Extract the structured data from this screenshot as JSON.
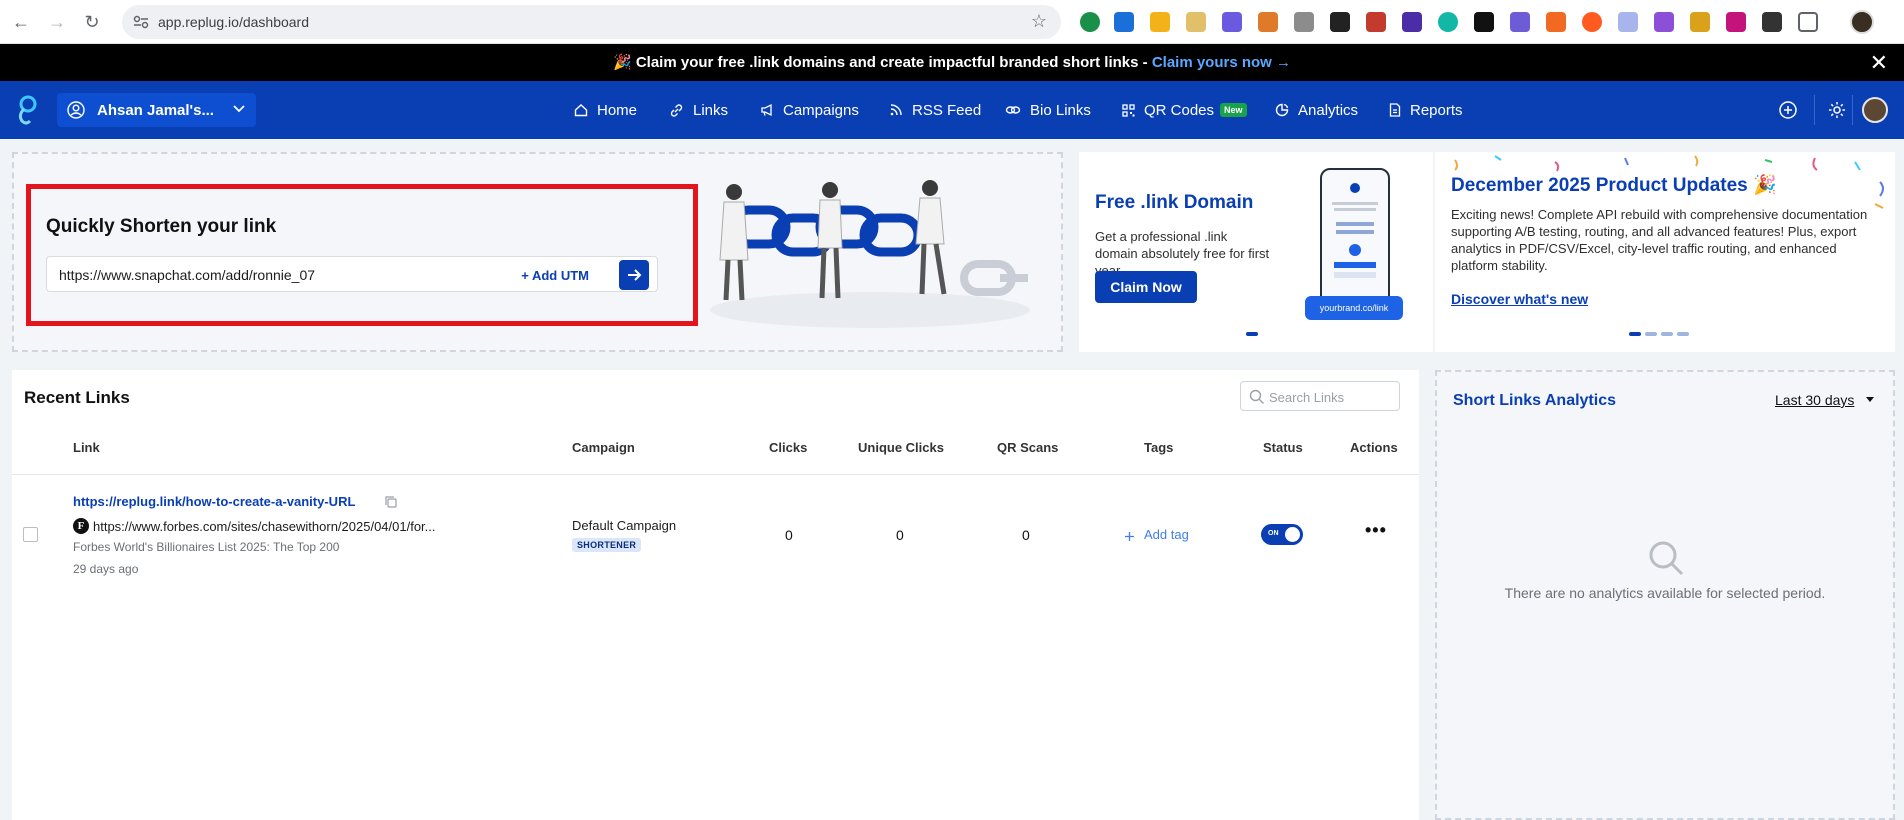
{
  "browser": {
    "url": "app.replug.io/dashboard"
  },
  "announcement": {
    "emoji": "🎉",
    "text": "Claim your free .link domains and create impactful branded short links -",
    "link": "Claim yours now →",
    "close": "✕"
  },
  "nav": {
    "workspace": "Ahsan Jamal's...",
    "items": [
      {
        "label": "Home",
        "icon": "home-icon"
      },
      {
        "label": "Links",
        "icon": "link-icon"
      },
      {
        "label": "Campaigns",
        "icon": "megaphone-icon"
      },
      {
        "label": "RSS Feed",
        "icon": "rss-icon"
      },
      {
        "label": "Bio Links",
        "icon": "bio-link-icon"
      },
      {
        "label": "QR Codes",
        "icon": "qr-code-icon",
        "badge": "New"
      },
      {
        "label": "Analytics",
        "icon": "analytics-icon"
      },
      {
        "label": "Reports",
        "icon": "report-icon"
      }
    ]
  },
  "shorten": {
    "title": "Quickly Shorten your link",
    "value": "https://www.snapchat.com/add/ronnie_07",
    "utm_label": "+ Add UTM"
  },
  "promo_domain": {
    "title": "Free .link Domain",
    "text": "Get a professional .link domain absolutely free for first year.",
    "button": "Claim Now",
    "phone_label": "yourbrand.co/link"
  },
  "promo_updates": {
    "title": "December 2025 Product Updates 🎉",
    "text": "Exciting news! Complete API rebuild with comprehensive documentation supporting A/B testing, routing, and all advanced features! Plus, export analytics in PDF/CSV/Excel, city-level traffic routing, and enhanced platform stability.",
    "link": "Discover what's new"
  },
  "recent_links": {
    "title": "Recent Links",
    "search_placeholder": "Search Links",
    "columns": [
      "Link",
      "Campaign",
      "Clicks",
      "Unique Clicks",
      "QR Scans",
      "Tags",
      "Status",
      "Actions"
    ],
    "rows": [
      {
        "short_url": "https://replug.link/how-to-create-a-vanity-URL",
        "favicon": "F",
        "long_url": "https://www.forbes.com/sites/chasewithorn/2025/04/01/for...",
        "page_title": "Forbes World's Billionaires List 2025: The Top 200",
        "age": "29 days ago",
        "campaign": "Default Campaign",
        "campaign_type": "SHORTENER",
        "clicks": "0",
        "unique_clicks": "0",
        "qr_scans": "0",
        "add_tag": "Add tag",
        "status": "ON",
        "actions": "•••"
      }
    ]
  },
  "analytics": {
    "title": "Short Links Analytics",
    "range": "Last 30 days",
    "empty": "There are no analytics available for selected period."
  }
}
